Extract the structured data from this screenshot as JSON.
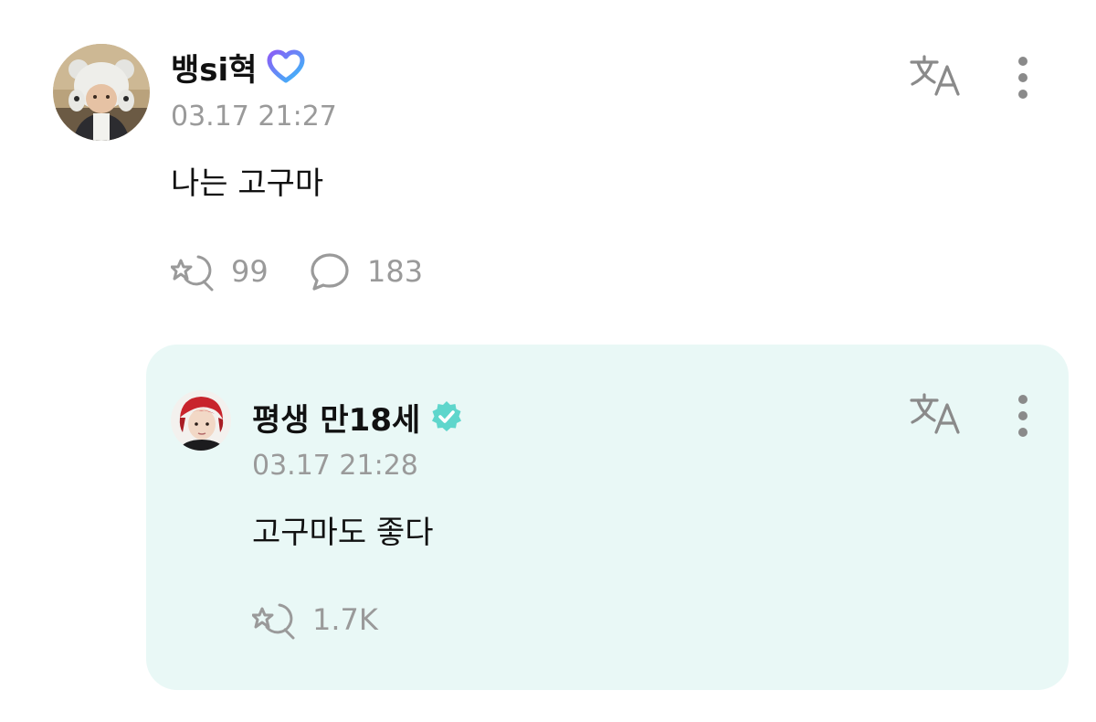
{
  "post": {
    "author": "뱅si혁",
    "badge_icon": "heart-badge-icon",
    "timestamp": "03.17 21:27",
    "text": "나는 고구마",
    "reaction_icon": "cheer-icon",
    "reaction_count": "99",
    "comment_icon": "comment-bubble-icon",
    "comment_count": "183",
    "translate_icon": "translate-icon",
    "more_icon": "more-vertical-icon"
  },
  "reply": {
    "author": "평생 만18세",
    "badge_icon": "verified-badge-icon",
    "timestamp": "03.17 21:28",
    "text": "고구마도 좋다",
    "reaction_icon": "cheer-icon",
    "reaction_count": "1.7K",
    "translate_icon": "translate-icon",
    "more_icon": "more-vertical-icon"
  },
  "colors": {
    "reply_background": "#e9f8f6",
    "meta_gray": "#9a9a9a",
    "verified_teal": "#5fd6cc",
    "heart_gradient_start": "#8b5cf6",
    "heart_gradient_end": "#38bdf8"
  }
}
